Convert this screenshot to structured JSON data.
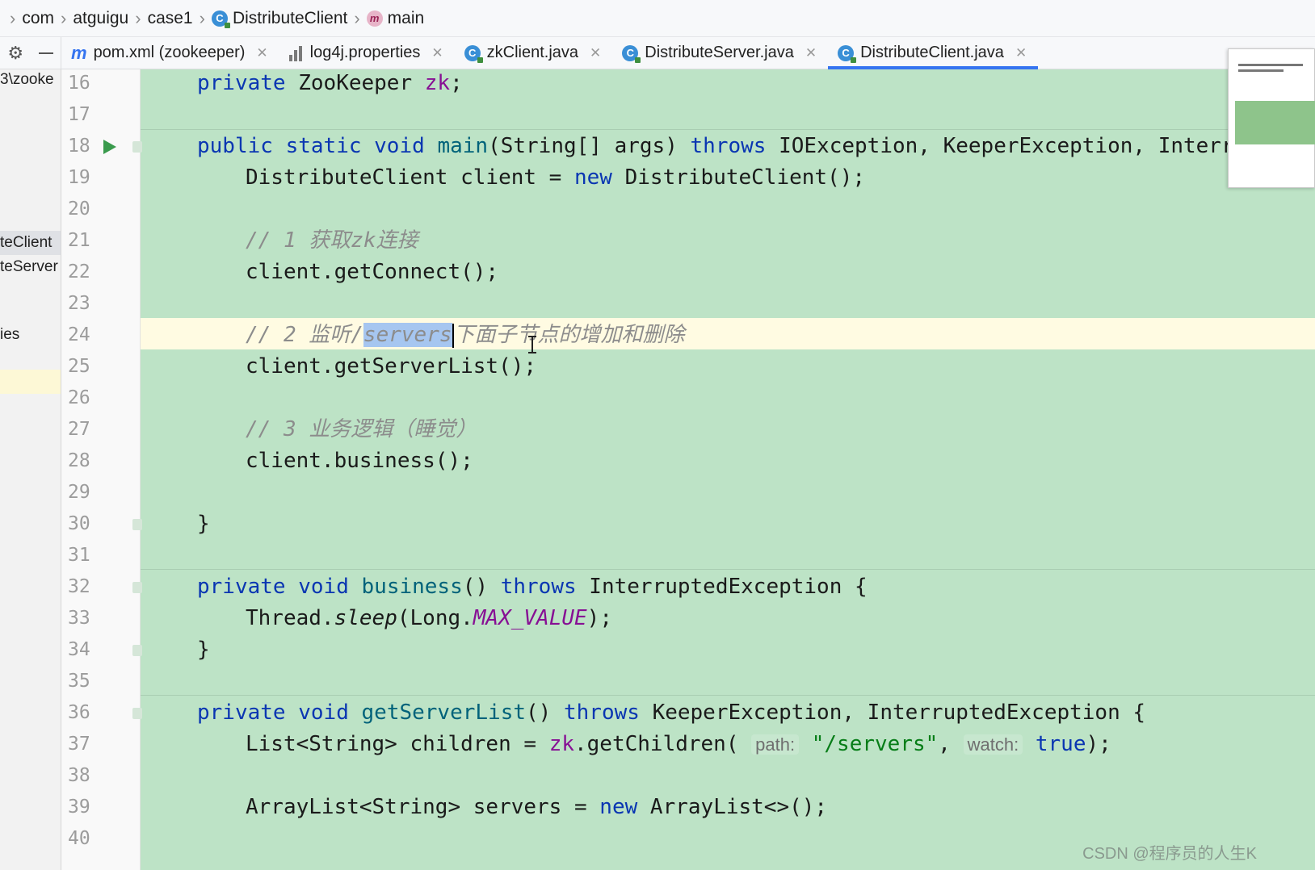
{
  "breadcrumb": {
    "items": [
      {
        "label": "com"
      },
      {
        "label": "atguigu"
      },
      {
        "label": "case1"
      },
      {
        "label": "DistributeClient",
        "icon": "class-icon"
      },
      {
        "label": "main",
        "icon": "method-icon"
      }
    ]
  },
  "tabs": [
    {
      "label": "pom.xml (zookeeper)",
      "icon": "maven-icon",
      "active": false
    },
    {
      "label": "log4j.properties",
      "icon": "properties-icon",
      "active": false
    },
    {
      "label": "zkClient.java",
      "icon": "class-icon",
      "active": false
    },
    {
      "label": "DistributeServer.java",
      "icon": "class-icon",
      "active": false
    },
    {
      "label": "DistributeClient.java",
      "icon": "class-icon",
      "active": true
    }
  ],
  "sidebar": {
    "items": [
      "3\\zooke",
      "teClient",
      "teServer",
      "ies"
    ]
  },
  "editor": {
    "line_numbers": [
      "16",
      "17",
      "18",
      "19",
      "20",
      "21",
      "22",
      "23",
      "24",
      "25",
      "26",
      "27",
      "28",
      "29",
      "30",
      "31",
      "32",
      "33",
      "34",
      "35",
      "36",
      "37",
      "38",
      "39",
      "40"
    ],
    "tokens": {
      "private": "private",
      "public": "public",
      "static": "static",
      "void": "void",
      "new": "new",
      "throws": "throws",
      "true": "true",
      "ZooKeeper": "ZooKeeper",
      "zk": "zk",
      "semicolon": ";",
      "main": "main",
      "main_params": "(String[] args) ",
      "main_exceptions": "IOException, KeeperException, Interrupt",
      "client_decl": "DistributeClient client = ",
      "client_ctor": "DistributeClient();",
      "comment1": "// 1 获取zk连接",
      "getConnect_call": "client.getConnect();",
      "comment2_prefix": "// 2 监听/",
      "comment2_selected": "servers",
      "comment2_suffix": "下面子节点的增加和删除",
      "getServerList_call": "client.getServerList();",
      "comment3": "// 3 业务逻辑（睡觉）",
      "business_call": "client.business();",
      "close_brace": "}",
      "business": "business",
      "business_sig": "() ",
      "interrupted_ex": "InterruptedException {",
      "thread_prefix": "Thread.",
      "sleep": "sleep",
      "long_prefix": "(Long.",
      "max_value": "MAX_VALUE",
      "sleep_end": ");",
      "getServerList": "getServerList",
      "gsl_sig": "() ",
      "gsl_exceptions": "KeeperException, InterruptedException {",
      "children_decl": "List<String> children = ",
      "getChildren_call": ".getChildren( ",
      "hint_path": "path:",
      "servers_path": "\"/servers\"",
      "comma": ", ",
      "hint_watch": "watch:",
      "children_end": ");",
      "arraylist_decl": "ArrayList<String> servers = ",
      "arraylist_ctor": "ArrayList<>();"
    }
  },
  "watermark": "CSDN @程序员的人生K",
  "colors": {
    "editor_bg": "#bde3c6",
    "keyword": "#0a36b2",
    "method": "#00627a",
    "string": "#067d17",
    "field": "#871094",
    "comment": "#8c8c8c",
    "current_line": "#fffbe2",
    "tab_active_underline": "#3574f0"
  }
}
